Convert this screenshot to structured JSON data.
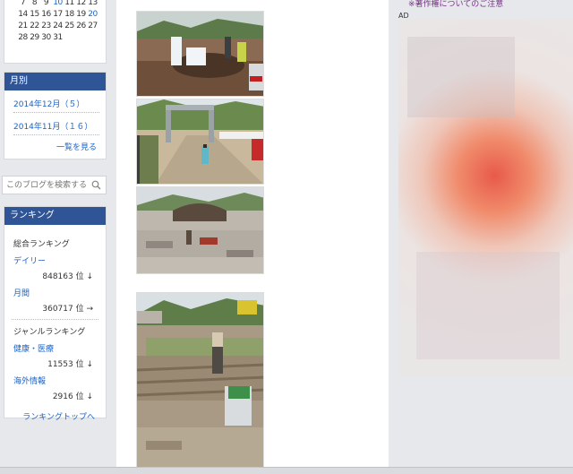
{
  "calendar": {
    "rows": [
      [
        "7",
        "8",
        "9",
        "10",
        "11",
        "12",
        "13"
      ],
      [
        "14",
        "15",
        "16",
        "17",
        "18",
        "19",
        "20"
      ],
      [
        "21",
        "22",
        "23",
        "24",
        "25",
        "26",
        "27"
      ],
      [
        "28",
        "29",
        "30",
        "31",
        "",
        "",
        ""
      ]
    ],
    "highlight_color": "#1a63c9"
  },
  "monthly": {
    "title": "月別",
    "items": [
      "2014年12月（５）",
      "2014年11月（１６）"
    ],
    "more_label": "一覧を見る"
  },
  "search": {
    "placeholder": "このブログを検索する",
    "icon": "search-icon"
  },
  "ranking": {
    "title": "ランキング",
    "overall_label": "総合ランキング",
    "daily_label": "デイリー",
    "daily_value": "848163 位 ↓",
    "monthly_label": "月間",
    "monthly_value": "360717 位 →",
    "genre_label": "ジャンルランキング",
    "health_label": "健康・医療",
    "health_value": "11553 位 ↓",
    "overseas_label": "海外情報",
    "overseas_value": "2916 位 ↓",
    "top_link": "ランキングトップへ"
  },
  "right": {
    "notice": "※著作権についてのご注意",
    "ad_label": "AD"
  },
  "colors": {
    "header_blue": "#2f5597",
    "link_blue": "#1a63c9",
    "notice_purple": "#7a2f8a"
  }
}
